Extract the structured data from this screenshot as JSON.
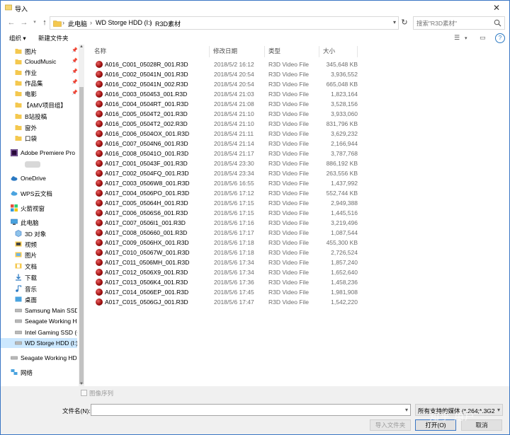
{
  "window": {
    "title": "导入"
  },
  "nav": {
    "breadcrumbs": [
      "此电脑",
      "WD Storge HDD (I:)",
      "R3D素材"
    ],
    "search_placeholder": "搜索\"R3D素材\""
  },
  "toolbar": {
    "organize": "组织 ▾",
    "new_folder": "新建文件夹"
  },
  "sidebar": {
    "items": [
      {
        "label": "图片",
        "pinned": true
      },
      {
        "label": "CloudMusic",
        "pinned": true
      },
      {
        "label": "作业",
        "pinned": true
      },
      {
        "label": "作品集",
        "pinned": true
      },
      {
        "label": "电影",
        "pinned": true
      },
      {
        "label": "【AMV项目组】",
        "pinned": false
      },
      {
        "label": "B站投稿",
        "pinned": false
      },
      {
        "label": "窗外",
        "pinned": false
      },
      {
        "label": "口袋",
        "pinned": false
      },
      {
        "label": "Adobe Premiere Pro",
        "pinned": false
      },
      {
        "label": "OneDrive",
        "pinned": false
      },
      {
        "label": "WPS云文档",
        "pinned": false
      },
      {
        "label": "火箭视窗",
        "pinned": false
      },
      {
        "label": "此电脑",
        "pinned": false
      },
      {
        "label": "3D 对象",
        "pinned": false
      },
      {
        "label": "视频",
        "pinned": false
      },
      {
        "label": "图片",
        "pinned": false
      },
      {
        "label": "文档",
        "pinned": false
      },
      {
        "label": "下载",
        "pinned": false
      },
      {
        "label": "音乐",
        "pinned": false
      },
      {
        "label": "桌面",
        "pinned": false
      },
      {
        "label": "Samsung Main SSD",
        "pinned": false
      },
      {
        "label": "Seagate Working HI",
        "pinned": false
      },
      {
        "label": "Intel Gaming SSD (G",
        "pinned": false
      },
      {
        "label": "WD Storge HDD (I:)",
        "pinned": false
      },
      {
        "label": "Seagate Working HD",
        "pinned": false
      },
      {
        "label": "网络",
        "pinned": false
      }
    ]
  },
  "columns": {
    "name": "名称",
    "date": "修改日期",
    "type": "类型",
    "size": "大小"
  },
  "files": [
    {
      "name": "A016_C001_05028R_001.R3D",
      "date": "2018/5/2 16:12",
      "type": "R3D Video File",
      "size": "345,648 KB"
    },
    {
      "name": "A016_C002_05041N_001.R3D",
      "date": "2018/5/4 20:54",
      "type": "R3D Video File",
      "size": "3,936,552"
    },
    {
      "name": "A016_C002_05041N_002.R3D",
      "date": "2018/5/4 20:54",
      "type": "R3D Video File",
      "size": "665,048 KB"
    },
    {
      "name": "A016_C003_050453_001.R3D",
      "date": "2018/5/4 21:03",
      "type": "R3D Video File",
      "size": "1,823,164"
    },
    {
      "name": "A016_C004_0504RT_001.R3D",
      "date": "2018/5/4 21:08",
      "type": "R3D Video File",
      "size": "3,528,156"
    },
    {
      "name": "A016_C005_0504T2_001.R3D",
      "date": "2018/5/4 21:10",
      "type": "R3D Video File",
      "size": "3,933,060"
    },
    {
      "name": "A016_C005_0504T2_002.R3D",
      "date": "2018/5/4 21:10",
      "type": "R3D Video File",
      "size": "831,796 KB"
    },
    {
      "name": "A016_C006_0504OX_001.R3D",
      "date": "2018/5/4 21:11",
      "type": "R3D Video File",
      "size": "3,629,232"
    },
    {
      "name": "A016_C007_0504N6_001.R3D",
      "date": "2018/5/4 21:14",
      "type": "R3D Video File",
      "size": "2,166,944"
    },
    {
      "name": "A016_C008_05041O_001.R3D",
      "date": "2018/5/4 21:17",
      "type": "R3D Video File",
      "size": "3,787,768"
    },
    {
      "name": "A017_C001_05043F_001.R3D",
      "date": "2018/5/4 23:30",
      "type": "R3D Video File",
      "size": "886,192 KB"
    },
    {
      "name": "A017_C002_0504FQ_001.R3D",
      "date": "2018/5/4 23:34",
      "type": "R3D Video File",
      "size": "263,556 KB"
    },
    {
      "name": "A017_C003_0506W8_001.R3D",
      "date": "2018/5/6 16:55",
      "type": "R3D Video File",
      "size": "1,437,992"
    },
    {
      "name": "A017_C004_0506PO_001.R3D",
      "date": "2018/5/6 17:12",
      "type": "R3D Video File",
      "size": "552,744 KB"
    },
    {
      "name": "A017_C005_05064H_001.R3D",
      "date": "2018/5/6 17:15",
      "type": "R3D Video File",
      "size": "2,949,388"
    },
    {
      "name": "A017_C006_0506S6_001.R3D",
      "date": "2018/5/6 17:15",
      "type": "R3D Video File",
      "size": "1,445,516"
    },
    {
      "name": "A017_C007_0506I1_001.R3D",
      "date": "2018/5/6 17:16",
      "type": "R3D Video File",
      "size": "3,219,496"
    },
    {
      "name": "A017_C008_050660_001.R3D",
      "date": "2018/5/6 17:17",
      "type": "R3D Video File",
      "size": "1,087,544"
    },
    {
      "name": "A017_C009_0506HX_001.R3D",
      "date": "2018/5/6 17:18",
      "type": "R3D Video File",
      "size": "455,300 KB"
    },
    {
      "name": "A017_C010_05067W_001.R3D",
      "date": "2018/5/6 17:18",
      "type": "R3D Video File",
      "size": "2,726,524"
    },
    {
      "name": "A017_C011_0506MH_001.R3D",
      "date": "2018/5/6 17:34",
      "type": "R3D Video File",
      "size": "1,857,240"
    },
    {
      "name": "A017_C012_0506X9_001.R3D",
      "date": "2018/5/6 17:34",
      "type": "R3D Video File",
      "size": "1,652,640"
    },
    {
      "name": "A017_C013_0506K4_001.R3D",
      "date": "2018/5/6 17:36",
      "type": "R3D Video File",
      "size": "1,458,236"
    },
    {
      "name": "A017_C014_0506EP_001.R3D",
      "date": "2018/5/6 17:45",
      "type": "R3D Video File",
      "size": "1,981,908"
    },
    {
      "name": "A017_C015_0506GJ_001.R3D",
      "date": "2018/5/6 17:47",
      "type": "R3D Video File",
      "size": "1,542,220"
    }
  ],
  "bottom": {
    "sequence_label": "图像序列",
    "filename_label": "文件名(N):",
    "filename_value": "",
    "filetype_value": "所有支持的媒体 (*.264;*.3G2;*",
    "import_folder": "导入文件夹",
    "open": "打开(O)",
    "cancel": "取消"
  },
  "watermark": "知乎 用户",
  "colors": {
    "accent": "#3a76c4",
    "selected": "#cce8ff",
    "r3d_icon": "#a01010"
  }
}
